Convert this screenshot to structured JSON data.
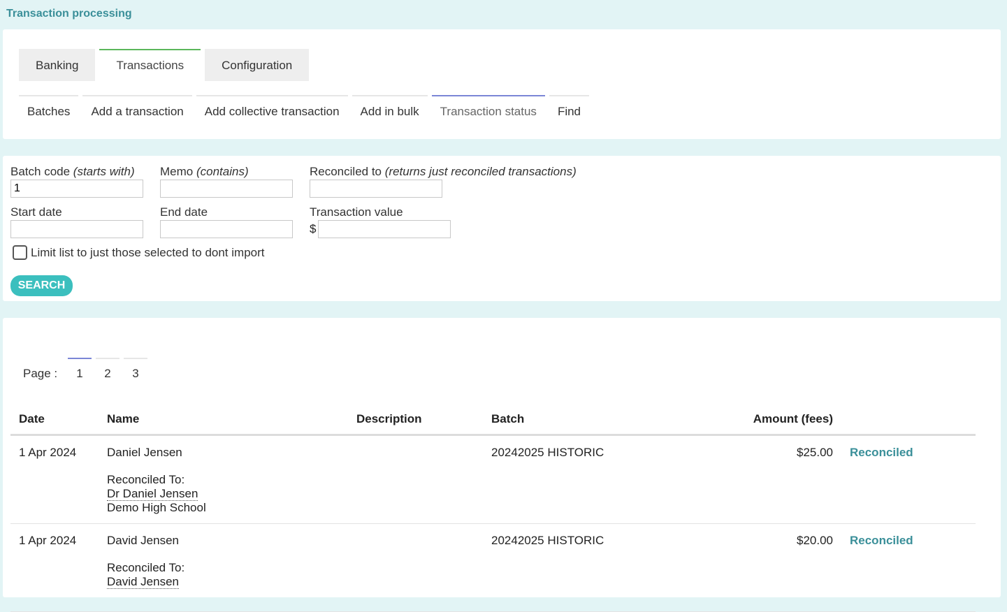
{
  "page": {
    "title": "Transaction processing"
  },
  "main_tabs": [
    {
      "label": "Banking"
    },
    {
      "label": "Transactions"
    },
    {
      "label": "Configuration"
    }
  ],
  "sub_tabs": [
    {
      "label": "Batches"
    },
    {
      "label": "Add a transaction"
    },
    {
      "label": "Add collective transaction"
    },
    {
      "label": "Add in bulk"
    },
    {
      "label": "Transaction status"
    },
    {
      "label": "Find"
    }
  ],
  "filters": {
    "batch_code": {
      "label": "Batch code",
      "hint": "(starts with)",
      "value": "1"
    },
    "memo": {
      "label": "Memo",
      "hint": "(contains)",
      "value": ""
    },
    "reconciled_to": {
      "label": "Reconciled to",
      "hint": "(returns just reconciled transactions)",
      "value": ""
    },
    "start_date": {
      "label": "Start date",
      "value": ""
    },
    "end_date": {
      "label": "End date",
      "value": ""
    },
    "transaction_value": {
      "label": "Transaction value",
      "prefix": "$",
      "value": ""
    },
    "limit_checkbox": {
      "label": "Limit list to just those selected to dont import",
      "checked": false
    },
    "search_button": "SEARCH"
  },
  "pager": {
    "label": "Page :",
    "pages": [
      "1",
      "2",
      "3"
    ],
    "current": "1"
  },
  "table": {
    "headers": {
      "date": "Date",
      "name": "Name",
      "description": "Description",
      "batch": "Batch",
      "amount": "Amount (fees)"
    },
    "rows": [
      {
        "date": "1 Apr 2024",
        "name": "Daniel Jensen",
        "description": "",
        "batch": "20242025 HISTORIC",
        "amount": "$25.00",
        "status": "Reconciled",
        "reconciled_label": "Reconciled To:",
        "reconciled_person": "Dr Daniel Jensen",
        "reconciled_org": "Demo High School"
      },
      {
        "date": "1 Apr 2024",
        "name": "David Jensen",
        "description": "",
        "batch": "20242025 HISTORIC",
        "amount": "$20.00",
        "status": "Reconciled",
        "reconciled_label": "Reconciled To:",
        "reconciled_person": "David Jensen",
        "reconciled_org": ""
      }
    ]
  }
}
